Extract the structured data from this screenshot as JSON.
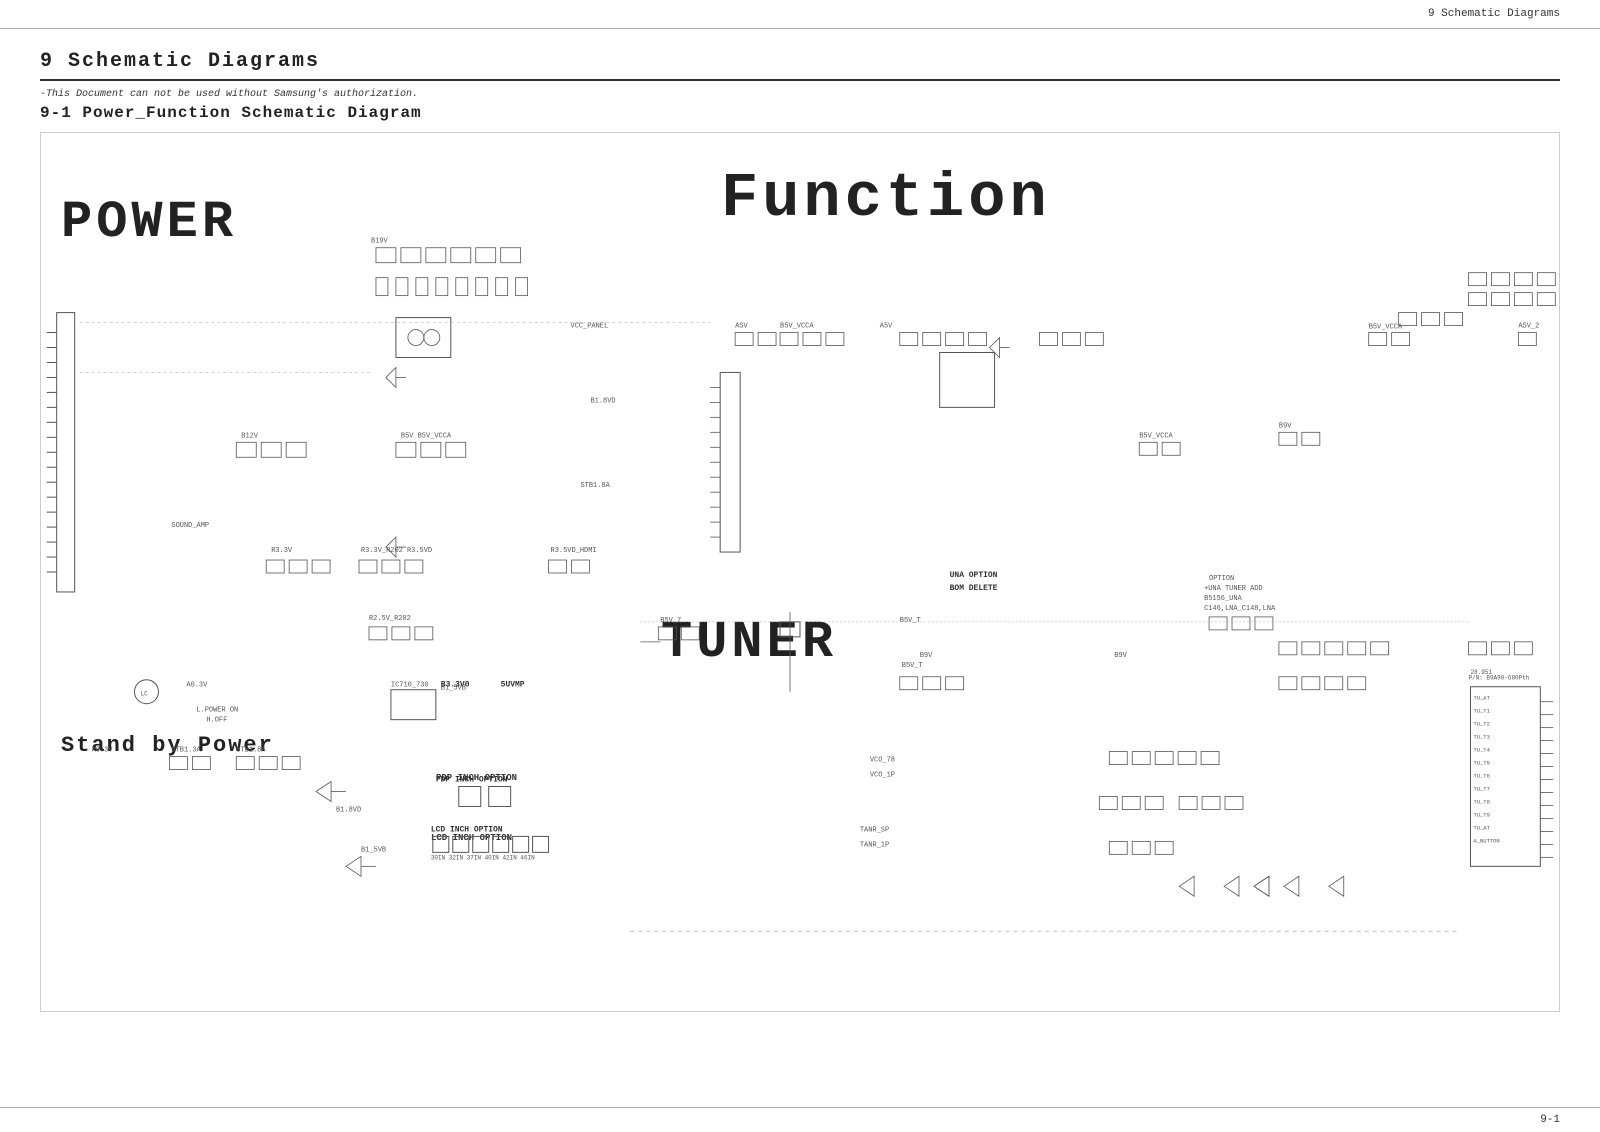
{
  "header": {
    "title": "9 Schematic Diagrams"
  },
  "footer": {
    "page_number": "9-1"
  },
  "document": {
    "section_number": "9",
    "section_title": "9 Schematic Diagrams",
    "notice": "-This Document can not be used without Samsung's authorization.",
    "subsection": "9-1 Power_Function Schematic Diagram"
  },
  "schematic": {
    "labels": {
      "power": "POWER",
      "function": "Function",
      "tuner": "TUNER",
      "standby": "Stand by Power",
      "pdp_inch_option": "PDP INCH OPTION",
      "lcd_inch_option": "LCD INCH OPTION",
      "inch_option": "Inch Option",
      "una_option": "UNA OPTION\nBOM DELETE"
    },
    "colors": {
      "line": "#333333",
      "background": "#ffffff",
      "component": "#555555"
    }
  }
}
